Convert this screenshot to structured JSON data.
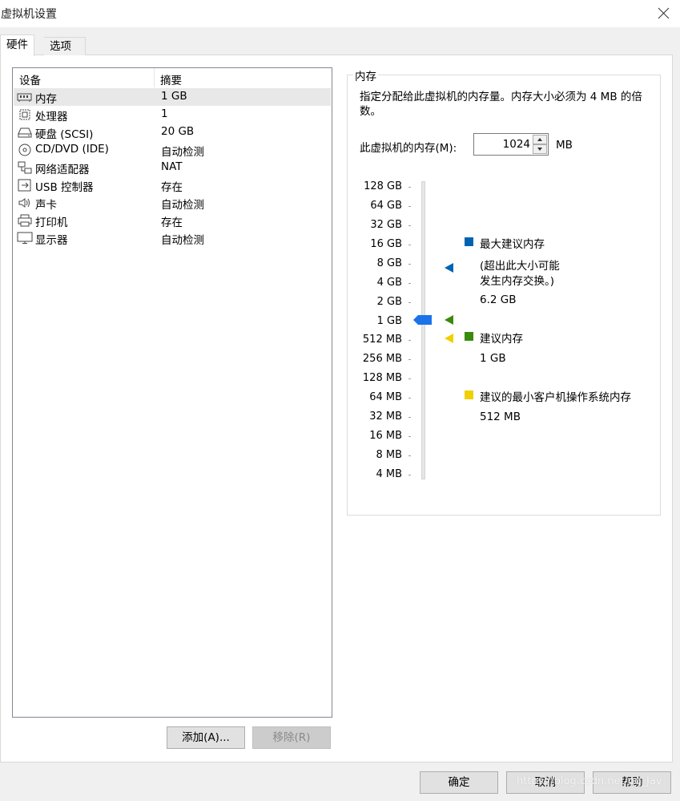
{
  "window": {
    "title": "虚拟机设置"
  },
  "tabs": [
    {
      "label": "硬件"
    },
    {
      "label": "选项"
    }
  ],
  "device_list": {
    "headers": {
      "device": "设备",
      "summary": "摘要"
    },
    "rows": [
      {
        "name": "内存",
        "summary": "1 GB",
        "icon": "memory-icon"
      },
      {
        "name": "处理器",
        "summary": "1",
        "icon": "processor-icon"
      },
      {
        "name": "硬盘 (SCSI)",
        "summary": "20 GB",
        "icon": "hard-disk-icon"
      },
      {
        "name": "CD/DVD (IDE)",
        "summary": "自动检测",
        "icon": "cd-dvd-icon"
      },
      {
        "name": "网络适配器",
        "summary": "NAT",
        "icon": "network-adapter-icon"
      },
      {
        "name": "USB 控制器",
        "summary": "存在",
        "icon": "usb-icon"
      },
      {
        "name": "声卡",
        "summary": "自动检测",
        "icon": "speaker-icon"
      },
      {
        "name": "打印机",
        "summary": "存在",
        "icon": "printer-icon"
      },
      {
        "name": "显示器",
        "summary": "自动检测",
        "icon": "monitor-icon"
      }
    ],
    "selected_index": 0
  },
  "buttons": {
    "add": "添加(A)...",
    "remove": "移除(R)",
    "ok": "确定",
    "cancel": "取消",
    "help": "帮助"
  },
  "memory": {
    "group_title": "内存",
    "description": "指定分配给此虚拟机的内存量。内存大小必须为 4 MB 的倍数。",
    "input_label": "此虚拟机的内存(M):",
    "value": "1024",
    "unit": "MB",
    "scale_labels": [
      "128 GB",
      "64 GB",
      "32 GB",
      "16 GB",
      "8 GB",
      "4 GB",
      "2 GB",
      "1 GB",
      "512 MB",
      "256 MB",
      "128 MB",
      "64 MB",
      "32 MB",
      "16 MB",
      "8 MB",
      "4 MB"
    ],
    "current_level": "1 GB",
    "legend": {
      "max": {
        "title": "最大建议内存",
        "note_line1": "(超出此大小可能",
        "note_line2": "发生内存交换。)",
        "value": "6.2 GB",
        "color": "#0063b1"
      },
      "recommended": {
        "title": "建议内存",
        "value": "1 GB",
        "color": "#3a8a0c"
      },
      "min": {
        "title": "建议的最小客户机操作系统内存",
        "value": "512 MB",
        "color": "#f0d000"
      }
    },
    "thumb_color": "#1a73e8"
  },
  "watermark": "https://blog.csdn.net/qq_Jav"
}
